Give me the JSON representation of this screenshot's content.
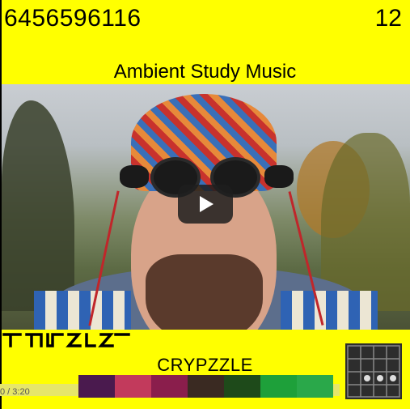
{
  "header": {
    "code": "6456596116",
    "count": "12"
  },
  "title": "Ambient Study Music",
  "video": {
    "play_icon": "play-icon",
    "time_display": "0 / 3:20"
  },
  "brand": "CRYPZZLE",
  "glyph_icon": "cipher-glyphs-icon",
  "color_swatches": [
    "#4a1a4e",
    "#c23a5c",
    "#8a1e4c",
    "#3a2a22",
    "#1e4a1a",
    "#1ea03a",
    "#2aa84a"
  ],
  "grid_icon": "grid-puzzle-icon",
  "colors": {
    "background": "#ffff00",
    "play_button": "#1e1e1e"
  }
}
